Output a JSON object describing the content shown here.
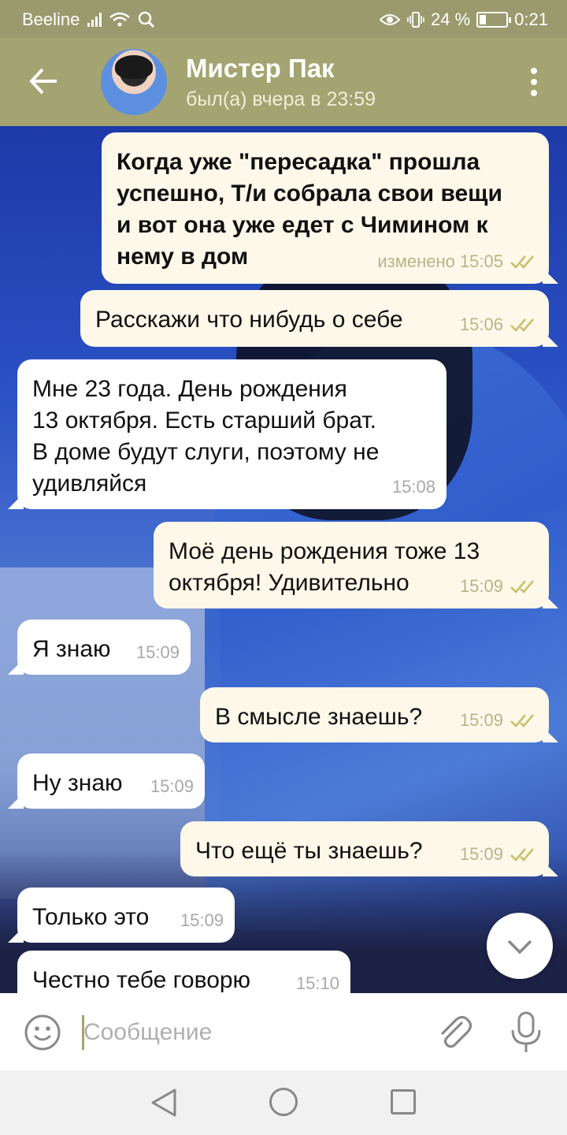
{
  "status_bar": {
    "carrier": "Beeline",
    "battery": "24 %",
    "battery_level": 0.24,
    "time": "0:21",
    "icons": [
      "signal-icon",
      "wifi-icon",
      "search-icon",
      "eye-icon",
      "vibrate-icon",
      "battery-icon"
    ]
  },
  "header": {
    "title": "Мистер Пак",
    "last_seen": "был(а) вчера в 23:59",
    "back_icon": "arrow-left-icon",
    "menu_icon": "more-vertical-icon",
    "accent": "#a4a472"
  },
  "messages": [
    {
      "dir": "out",
      "bold": true,
      "text": "Когда уже \"пересадка\" прошла\nуспешно, Т/и собрала свои вещи\nи вот она уже едет с Чимином к\nнему в дом",
      "time": "изменено 15:05",
      "read": true
    },
    {
      "dir": "out",
      "text": "Расскажи что нибудь о себе",
      "time": "15:06",
      "read": true
    },
    {
      "dir": "in",
      "text": "Мне 23 года. День рождения\n13 октября. Есть старший брат.\nВ доме будут слуги, поэтому не\nудивляйся",
      "time": "15:08"
    },
    {
      "dir": "out",
      "text": "Моё день рождения тоже 13\nоктября! Удивительно",
      "time": "15:09",
      "read": true
    },
    {
      "dir": "in",
      "text": "Я знаю",
      "time": "15:09"
    },
    {
      "dir": "out",
      "text": "В смысле знаешь?",
      "time": "15:09",
      "read": true
    },
    {
      "dir": "in",
      "text": "Ну знаю",
      "time": "15:09"
    },
    {
      "dir": "out",
      "text": "Что ещё ты знаешь?",
      "time": "15:09",
      "read": true
    },
    {
      "dir": "in",
      "text": "Только это",
      "time": "15:09"
    },
    {
      "dir": "in",
      "text": "Честно тебе говорю",
      "time": "15:10"
    }
  ],
  "input": {
    "placeholder": "Сообщение",
    "value": ""
  },
  "colors": {
    "out_bubble": "#fdf8e9",
    "in_bubble": "#ffffff",
    "checks": "#c8bf6a"
  }
}
